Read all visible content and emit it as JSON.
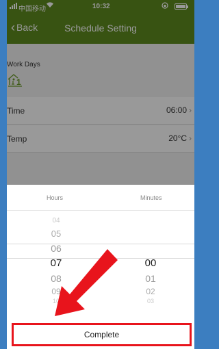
{
  "status_bar": {
    "carrier": "中国移动",
    "time": "10:32"
  },
  "nav": {
    "back_label": "Back",
    "title": "Schedule Setting"
  },
  "schedule": {
    "section_label": "Work Days",
    "rows": [
      {
        "label": "Time",
        "value": "06:00"
      },
      {
        "label": "Temp",
        "value": "20°C"
      }
    ]
  },
  "picker": {
    "hours_label": "Hours",
    "minutes_label": "Minutes",
    "hours": [
      "04",
      "05",
      "06",
      "07",
      "08",
      "09",
      "10"
    ],
    "minutes": [
      "00",
      "01",
      "02",
      "03"
    ],
    "selected_hour": "07",
    "selected_minute": "00",
    "complete_label": "Complete"
  },
  "colors": {
    "header_green": "#5e8a1f",
    "accent_red": "#e8141c",
    "outer_blue": "#3c7ec0"
  }
}
